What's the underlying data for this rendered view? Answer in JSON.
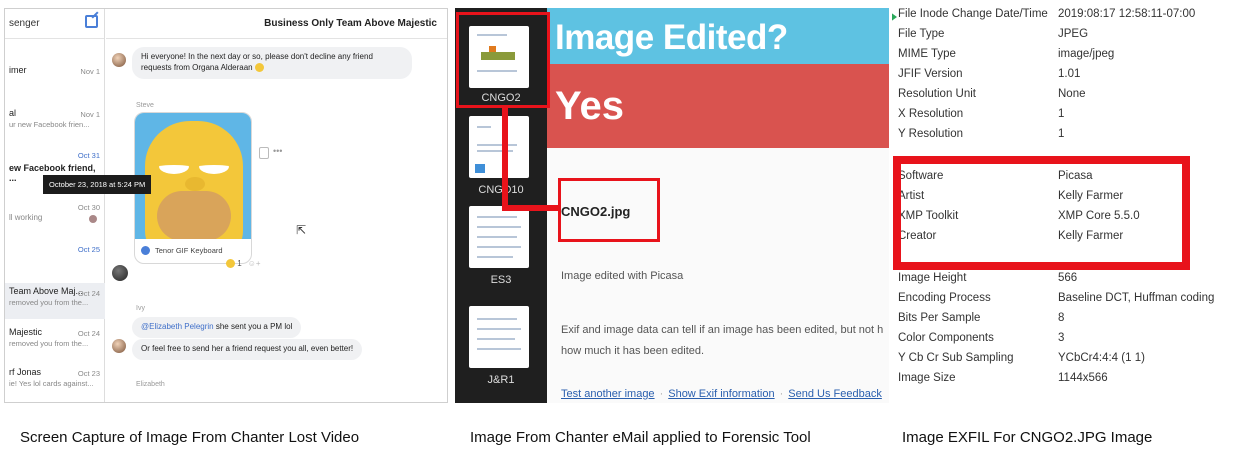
{
  "left": {
    "app_title": "senger",
    "chat_title": "Business Only Team Above Majestic",
    "conversations": [
      {
        "name": "imer",
        "snippet": "",
        "date": "Nov 1"
      },
      {
        "name": "al",
        "snippet": "ur new Facebook frien...",
        "date": "Nov 1"
      },
      {
        "name": "ew Facebook friend, ...",
        "snippet": "",
        "date": "Oct 31"
      },
      {
        "name": "ll working",
        "snippet": "",
        "date": "Oct 30"
      },
      {
        "name": "",
        "snippet": "",
        "date": "Oct 25"
      },
      {
        "name": "Team Above Maj...",
        "snippet": "removed you from the...",
        "date": "Oct 24"
      },
      {
        "name": "Majestic",
        "snippet": "removed you from the...",
        "date": "Oct 24"
      },
      {
        "name": "rf Jonas",
        "snippet": "ie! Yes lol cards against...",
        "date": "Oct 23"
      }
    ],
    "messages": {
      "first": "Hi everyone! In the next day or so, please don't decline any friend requests from Organa Alderaan",
      "steve_sender": "Steve",
      "gif_source": "Tenor GIF Keyboard",
      "reaction_count": "1",
      "tooltip": "October 23, 2018 at 5:24 PM",
      "ivy_sender": "Ivy",
      "mention": "@Elizabeth Pelegrin",
      "mention_rest": " she sent you a PM lol",
      "second": "Or feel free to send her a friend request you all, even better!",
      "elizabeth_sender": "Elizabeth"
    }
  },
  "middle": {
    "thumbnails": [
      "CNGO2",
      "CNGO10",
      "ES3",
      "J&R1"
    ],
    "question": "Image Edited?",
    "answer": "Yes",
    "file_name": "CNGO2.jpg",
    "edited_with": "Image edited with Picasa",
    "note_line1": "Exif and image data can tell if an image has been edited, but not h",
    "note_line2": "how much it has been edited.",
    "links": [
      "Test another image",
      "Show Exif information",
      "Send Us Feedback"
    ]
  },
  "right": {
    "exif": [
      {
        "key": "File Inode Change Date/Time",
        "value": "2019:08:17 12:58:11-07:00"
      },
      {
        "key": "File Type",
        "value": "JPEG"
      },
      {
        "key": "MIME Type",
        "value": "image/jpeg"
      },
      {
        "key": "JFIF Version",
        "value": "1.01"
      },
      {
        "key": "Resolution Unit",
        "value": "None"
      },
      {
        "key": "X Resolution",
        "value": "1"
      },
      {
        "key": "Y Resolution",
        "value": "1"
      },
      {
        "key": "Software",
        "value": "Picasa"
      },
      {
        "key": "Artist",
        "value": "Kelly Farmer"
      },
      {
        "key": "XMP Toolkit",
        "value": "XMP Core 5.5.0"
      },
      {
        "key": "Creator",
        "value": "Kelly Farmer"
      },
      {
        "key": "Image Height",
        "value": "566"
      },
      {
        "key": "Encoding Process",
        "value": "Baseline DCT, Huffman coding"
      },
      {
        "key": "Bits Per Sample",
        "value": "8"
      },
      {
        "key": "Color Components",
        "value": "3"
      },
      {
        "key": "Y Cb Cr Sub Sampling",
        "value": "YCbCr4:4:4 (1 1)"
      },
      {
        "key": "Image Size",
        "value": "1144x566"
      }
    ]
  },
  "captions": {
    "left": "Screen Capture of Image From Chanter Lost Video",
    "middle": "Image From Chanter eMail applied to Forensic Tool",
    "right": "Image EXFIL For CNGO2.JPG Image"
  },
  "colors": {
    "highlight": "#e8131b",
    "header_blue": "#5ec2e2",
    "answer_red": "#d9534f",
    "link": "#2a5fae"
  }
}
